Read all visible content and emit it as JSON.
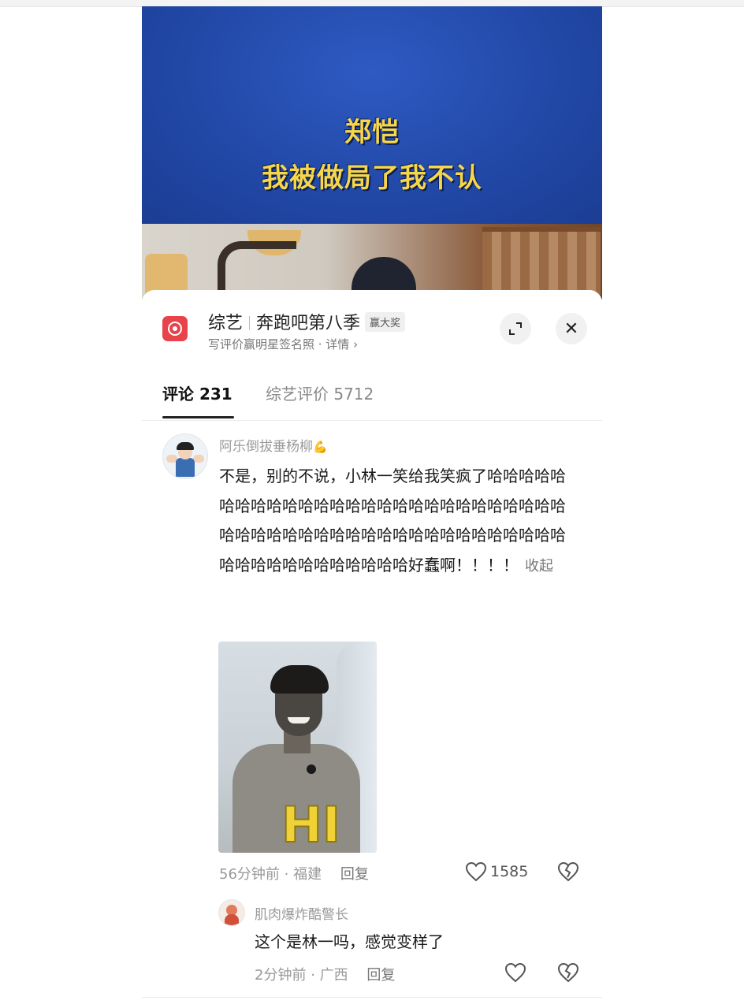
{
  "video": {
    "caption_line1": "郑恺",
    "caption_line2": "我被做局了我不认"
  },
  "header": {
    "category": "综艺",
    "show_title": "奔跑吧第八季",
    "badge": "赢大奖",
    "subtitle": "写评价赢明星签名照 · 详情 ›",
    "expand_icon": "expand-icon",
    "close_icon": "close-icon",
    "close_glyph": "✕"
  },
  "tabs": [
    {
      "label": "评论 231"
    },
    {
      "label": "综艺评价 5712"
    }
  ],
  "comment": {
    "username": "阿乐倒拔垂杨柳",
    "username_emoji": "💪",
    "text": "不是，别的不说，小林一笑给我笑疯了哈哈哈哈哈哈哈哈哈哈哈哈哈哈哈哈哈哈哈哈哈哈哈哈哈哈哈哈哈哈哈哈哈哈哈哈哈哈哈哈哈哈哈哈哈哈哈哈哈哈哈哈哈哈哈哈哈哈哈哈哈好蠢啊！！！！",
    "collapse_label": "收起",
    "photo_text": "HI",
    "time": "56分钟前",
    "location": "福建",
    "reply_label": "回复",
    "like_count": "1585"
  },
  "reply": {
    "username": "肌肉爆炸酷警长",
    "text": "这个是林一吗，感觉变样了",
    "time": "2分钟前",
    "location": "广西",
    "reply_label": "回复"
  },
  "colors": {
    "accent_red": "#e8424a",
    "caption_yellow": "#f6d64a",
    "video_blue": "#2249a8"
  }
}
